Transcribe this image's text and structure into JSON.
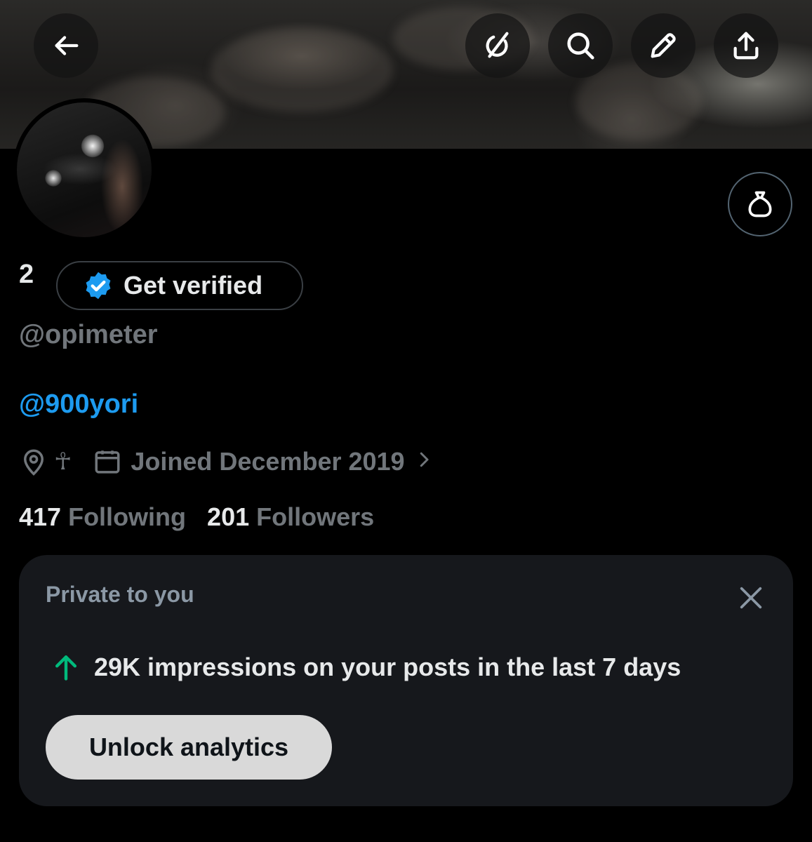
{
  "header": {
    "back_icon": "arrow-left-icon",
    "actions": [
      "grok-icon",
      "search-icon",
      "edit-pencil-icon",
      "share-icon"
    ]
  },
  "profile": {
    "display_name": "2",
    "verify_label": "Get verified",
    "handle": "@opimeter",
    "bio_mention": "@900yori",
    "location": "☥",
    "joined": "Joined December 2019",
    "following_count": "417",
    "following_label": "Following",
    "followers_count": "201",
    "followers_label": "Followers",
    "side_button_icon": "money-bag-icon"
  },
  "analytics_card": {
    "title": "Private to you",
    "impressions_text": "29K impressions on your posts in the last 7 days",
    "trend": "up",
    "unlock_label": "Unlock analytics"
  },
  "colors": {
    "background": "#000000",
    "accent_blue": "#1d9bf0",
    "muted_gray": "#71767b",
    "trend_green": "#00ba7c",
    "card_bg": "#16181c"
  }
}
